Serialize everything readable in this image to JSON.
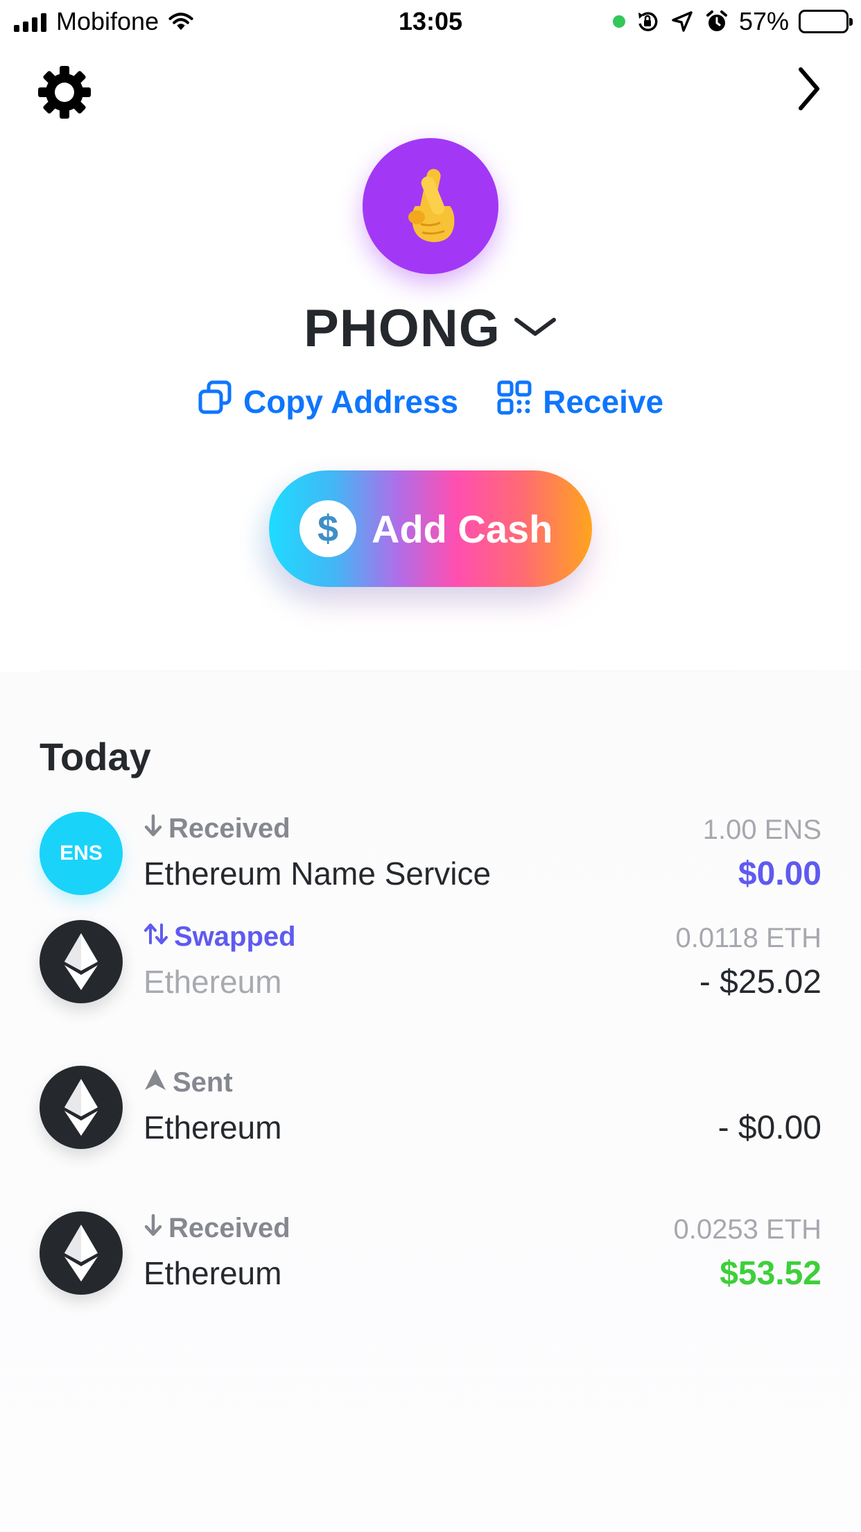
{
  "status_bar": {
    "carrier": "Mobifone",
    "time": "13:05",
    "battery_percent": "57%",
    "battery_level": 0.57
  },
  "header": {
    "settings_icon": "gear-icon",
    "forward_icon": "chevron-right-icon"
  },
  "profile": {
    "avatar_emoji": "🤞",
    "avatar_color": "#a238f5",
    "name": "PHONG",
    "copy_address_label": "Copy Address",
    "receive_label": "Receive",
    "accent_color": "#0e76fd"
  },
  "add_cash": {
    "label": "Add Cash",
    "coin_symbol": "$"
  },
  "activity": {
    "section_title": "Today",
    "transactions": [
      {
        "icon": "ENS",
        "status": "Received",
        "status_icon": "arrow-down-icon",
        "name": "Ethereum Name Service",
        "amount": "1.00 ENS",
        "value": "$0.00"
      },
      {
        "icon": "eth-icon",
        "status": "Swapped",
        "status_icon": "swap-icon",
        "name": "Ethereum",
        "amount": "0.0118 ETH",
        "value": "- $25.02"
      },
      {
        "icon": "eth-icon",
        "status": "Sent",
        "status_icon": "sent-arrow-icon",
        "name": "Ethereum",
        "amount": "",
        "value": "- $0.00"
      },
      {
        "icon": "eth-icon",
        "status": "Received",
        "status_icon": "arrow-down-icon",
        "name": "Ethereum",
        "amount": "0.0253 ETH",
        "value": "$53.52"
      }
    ]
  }
}
